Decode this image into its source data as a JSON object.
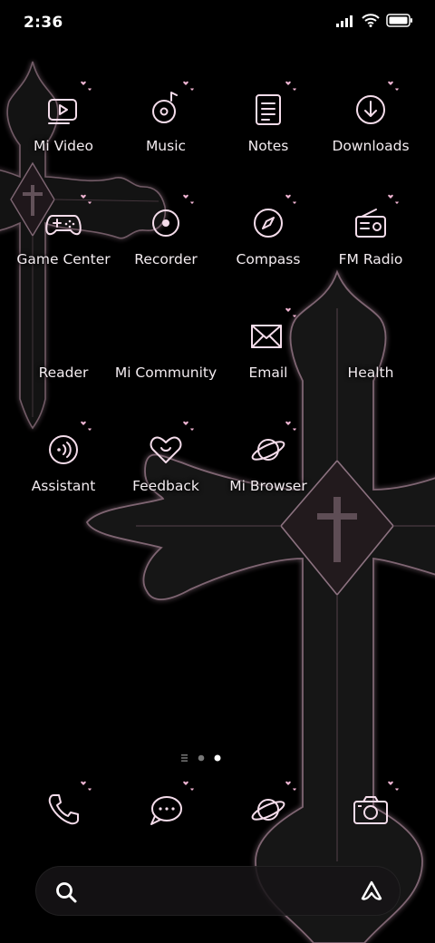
{
  "status_bar": {
    "time": "2:36",
    "icons": [
      "signal-icon",
      "wifi-icon",
      "battery-icon"
    ]
  },
  "colors": {
    "icon_stroke": "#f4dcea",
    "heart": "#f2b6d4",
    "cross_body": "#1a1416",
    "cross_edge": "#8a6f7d",
    "label": "#f3ecf0"
  },
  "apps": [
    {
      "label": "Mi Video",
      "icon": "video-icon"
    },
    {
      "label": "Music",
      "icon": "music-icon"
    },
    {
      "label": "Notes",
      "icon": "notes-icon"
    },
    {
      "label": "Downloads",
      "icon": "download-icon"
    },
    {
      "label": "Game Center",
      "icon": "gamepad-icon"
    },
    {
      "label": "Recorder",
      "icon": "recorder-icon"
    },
    {
      "label": "Compass",
      "icon": "compass-icon"
    },
    {
      "label": "FM Radio",
      "icon": "radio-icon"
    },
    {
      "label": "Reader",
      "icon": ""
    },
    {
      "label": "Mi Community",
      "icon": ""
    },
    {
      "label": "Email",
      "icon": "email-icon"
    },
    {
      "label": "Health",
      "icon": ""
    },
    {
      "label": "Assistant",
      "icon": "assistant-icon"
    },
    {
      "label": "Feedback",
      "icon": "feedback-heart-icon"
    },
    {
      "label": "Mi Browser",
      "icon": "browser-planet-icon"
    }
  ],
  "page_indicator": {
    "pages": 3,
    "current": 3
  },
  "dock": [
    {
      "name": "phone",
      "icon": "phone-icon"
    },
    {
      "name": "messages",
      "icon": "message-bubble-icon"
    },
    {
      "name": "browser",
      "icon": "browser-planet-icon"
    },
    {
      "name": "camera",
      "icon": "camera-icon"
    }
  ],
  "search": {
    "icons": [
      "search-icon",
      "app-vault-icon"
    ]
  }
}
